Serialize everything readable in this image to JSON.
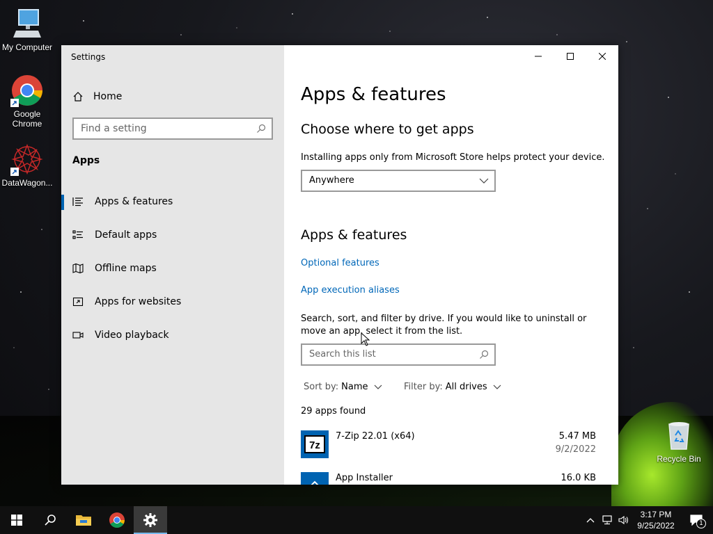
{
  "desktop": {
    "icons": [
      {
        "label": "My Computer"
      },
      {
        "label": "Google Chrome"
      },
      {
        "label": "DataWagon..."
      },
      {
        "label": "Recycle Bin"
      }
    ]
  },
  "window": {
    "title": "Settings",
    "sidebar": {
      "home_label": "Home",
      "search_placeholder": "Find a setting",
      "section": "Apps",
      "items": [
        {
          "label": "Apps & features",
          "icon": "list-icon",
          "active": true
        },
        {
          "label": "Default apps",
          "icon": "default-apps-icon"
        },
        {
          "label": "Offline maps",
          "icon": "map-icon"
        },
        {
          "label": "Apps for websites",
          "icon": "link-box-icon"
        },
        {
          "label": "Video playback",
          "icon": "video-icon"
        }
      ]
    },
    "content": {
      "page_title": "Apps & features",
      "choose_heading": "Choose where to get apps",
      "choose_desc": "Installing apps only from Microsoft Store helps protect your device.",
      "source_dropdown": "Anywhere",
      "apps_heading": "Apps & features",
      "optional_features": "Optional features",
      "execution_aliases": "App execution aliases",
      "list_desc": "Search, sort, and filter by drive. If you would like to uninstall or move an app, select it from the list.",
      "list_search_placeholder": "Search this list",
      "sort_label": "Sort by:",
      "sort_value": "Name",
      "filter_label": "Filter by:",
      "filter_value": "All drives",
      "apps_found": "29 apps found",
      "apps": [
        {
          "name": "7-Zip 22.01 (x64)",
          "size": "5.47 MB",
          "date": "9/2/2022"
        },
        {
          "name": "App Installer",
          "size": "16.0 KB",
          "date": ""
        }
      ]
    }
  },
  "taskbar": {
    "time": "3:17 PM",
    "date": "9/25/2022",
    "notification_count": "1"
  },
  "colors": {
    "accent": "#0063b1",
    "link": "#0067b8",
    "sidebar_bg": "#e6e6e6",
    "taskbar_bg": "#101010"
  }
}
